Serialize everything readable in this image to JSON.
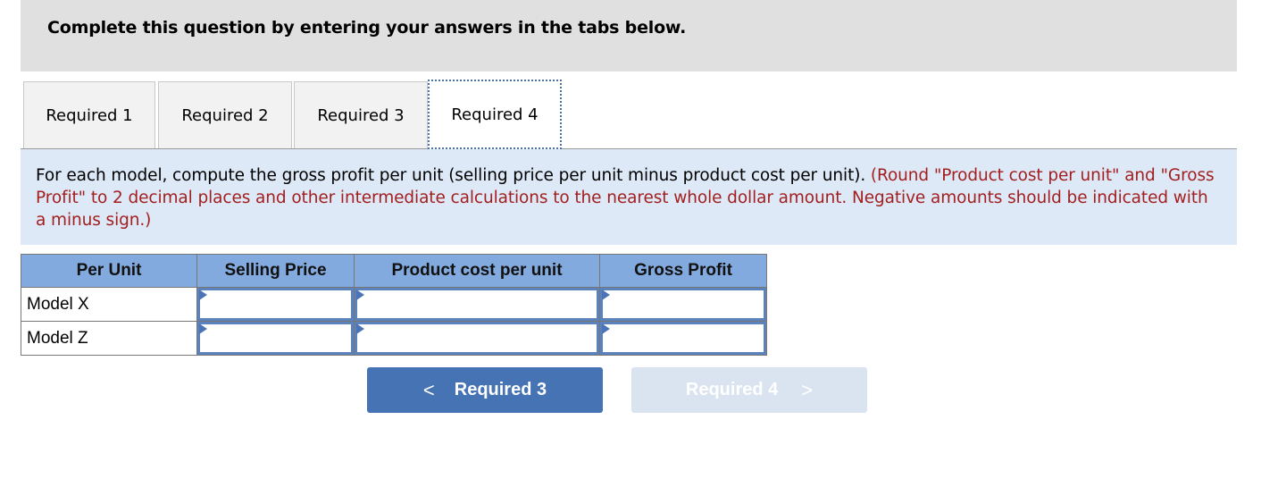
{
  "header": {
    "title": "Complete this question by entering your answers in the tabs below."
  },
  "tabs": [
    {
      "label": "Required 1",
      "active": false
    },
    {
      "label": "Required 2",
      "active": false
    },
    {
      "label": "Required 3",
      "active": false
    },
    {
      "label": "Required 4",
      "active": true
    }
  ],
  "instructions": {
    "main": "For each model, compute the gross profit per unit (selling price per unit minus product cost per unit).",
    "note": "(Round \"Product cost per unit\"  and \"Gross Profit\" to 2 decimal places and other intermediate calculations to the nearest whole dollar amount. Negative amounts should be indicated with a minus sign.)"
  },
  "table": {
    "headers": [
      "Per Unit",
      "Selling Price",
      "Product cost per unit",
      "Gross Profit"
    ],
    "rows": [
      {
        "label": "Model X",
        "selling_price": "",
        "product_cost": "",
        "gross_profit": ""
      },
      {
        "label": "Model Z",
        "selling_price": "",
        "product_cost": "",
        "gross_profit": ""
      }
    ]
  },
  "navigation": {
    "prev_label": "Required 3",
    "prev_icon": "chevron-left-icon",
    "prev_glyph": "<",
    "next_label": "Required 4",
    "next_icon": "chevron-right-icon",
    "next_glyph": ">",
    "next_disabled": true
  },
  "colors": {
    "header_bg": "#e0e0e0",
    "instruction_bg": "#dde9f6",
    "note_text": "#a31f1f",
    "table_header_bg": "#83aade",
    "input_border": "#5b82bd",
    "prev_button": "#4673b4",
    "next_button_disabled": "#dae4f1"
  }
}
